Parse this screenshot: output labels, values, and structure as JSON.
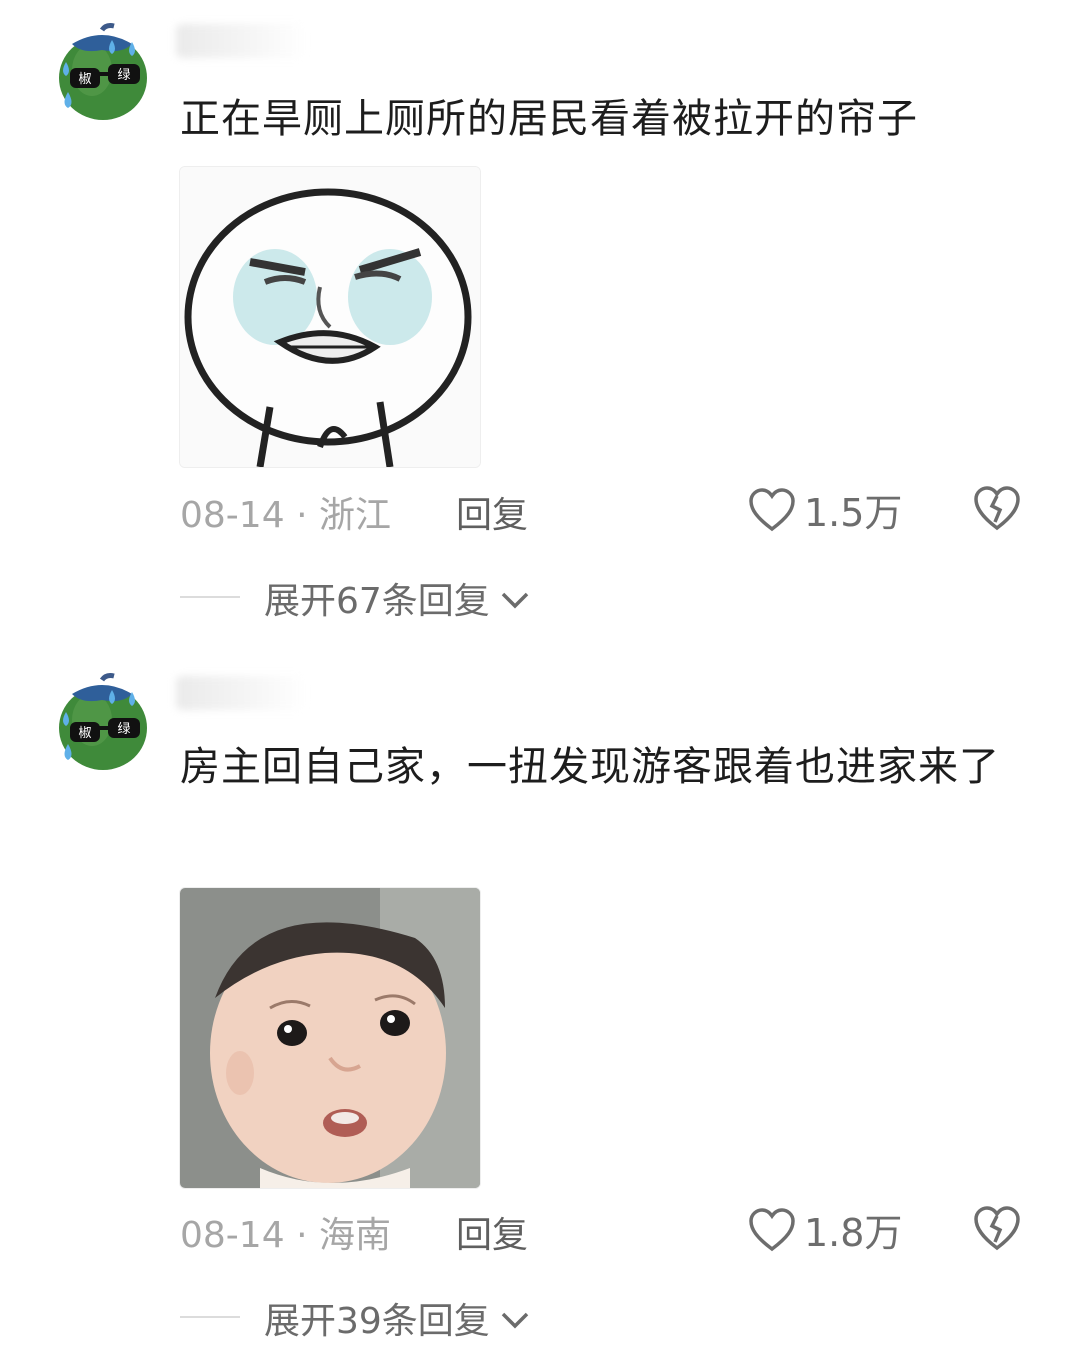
{
  "comments": [
    {
      "text": "正在旱厕上厕所的居民看着被拉开的帘子",
      "avatar_badge": [
        "椒",
        "绿"
      ],
      "date": "08-14",
      "sep": "·",
      "location": "浙江",
      "reply_label": "回复",
      "likes": "1.5万",
      "expand_label": "展开67条回复",
      "sticker": "angry-face-meme",
      "icons": {
        "like": "heart-outline-icon",
        "dislike": "broken-heart-icon",
        "expand": "chevron-down-icon"
      }
    },
    {
      "text": "房主回自己家，一扭发现游客跟着也进家来了",
      "avatar_badge": [
        "椒",
        "绿"
      ],
      "date": "08-14",
      "sep": "·",
      "location": "海南",
      "reply_label": "回复",
      "likes": "1.8万",
      "expand_label": "展开39条回复",
      "sticker": "baby-confused-face",
      "icons": {
        "like": "heart-outline-icon",
        "dislike": "broken-heart-icon",
        "expand": "chevron-down-icon"
      }
    }
  ],
  "colors": {
    "text": "#1d1d1d",
    "meta": "#a6a6a6",
    "icon": "#6d6d6d",
    "pepper": "#3f8a3a"
  }
}
